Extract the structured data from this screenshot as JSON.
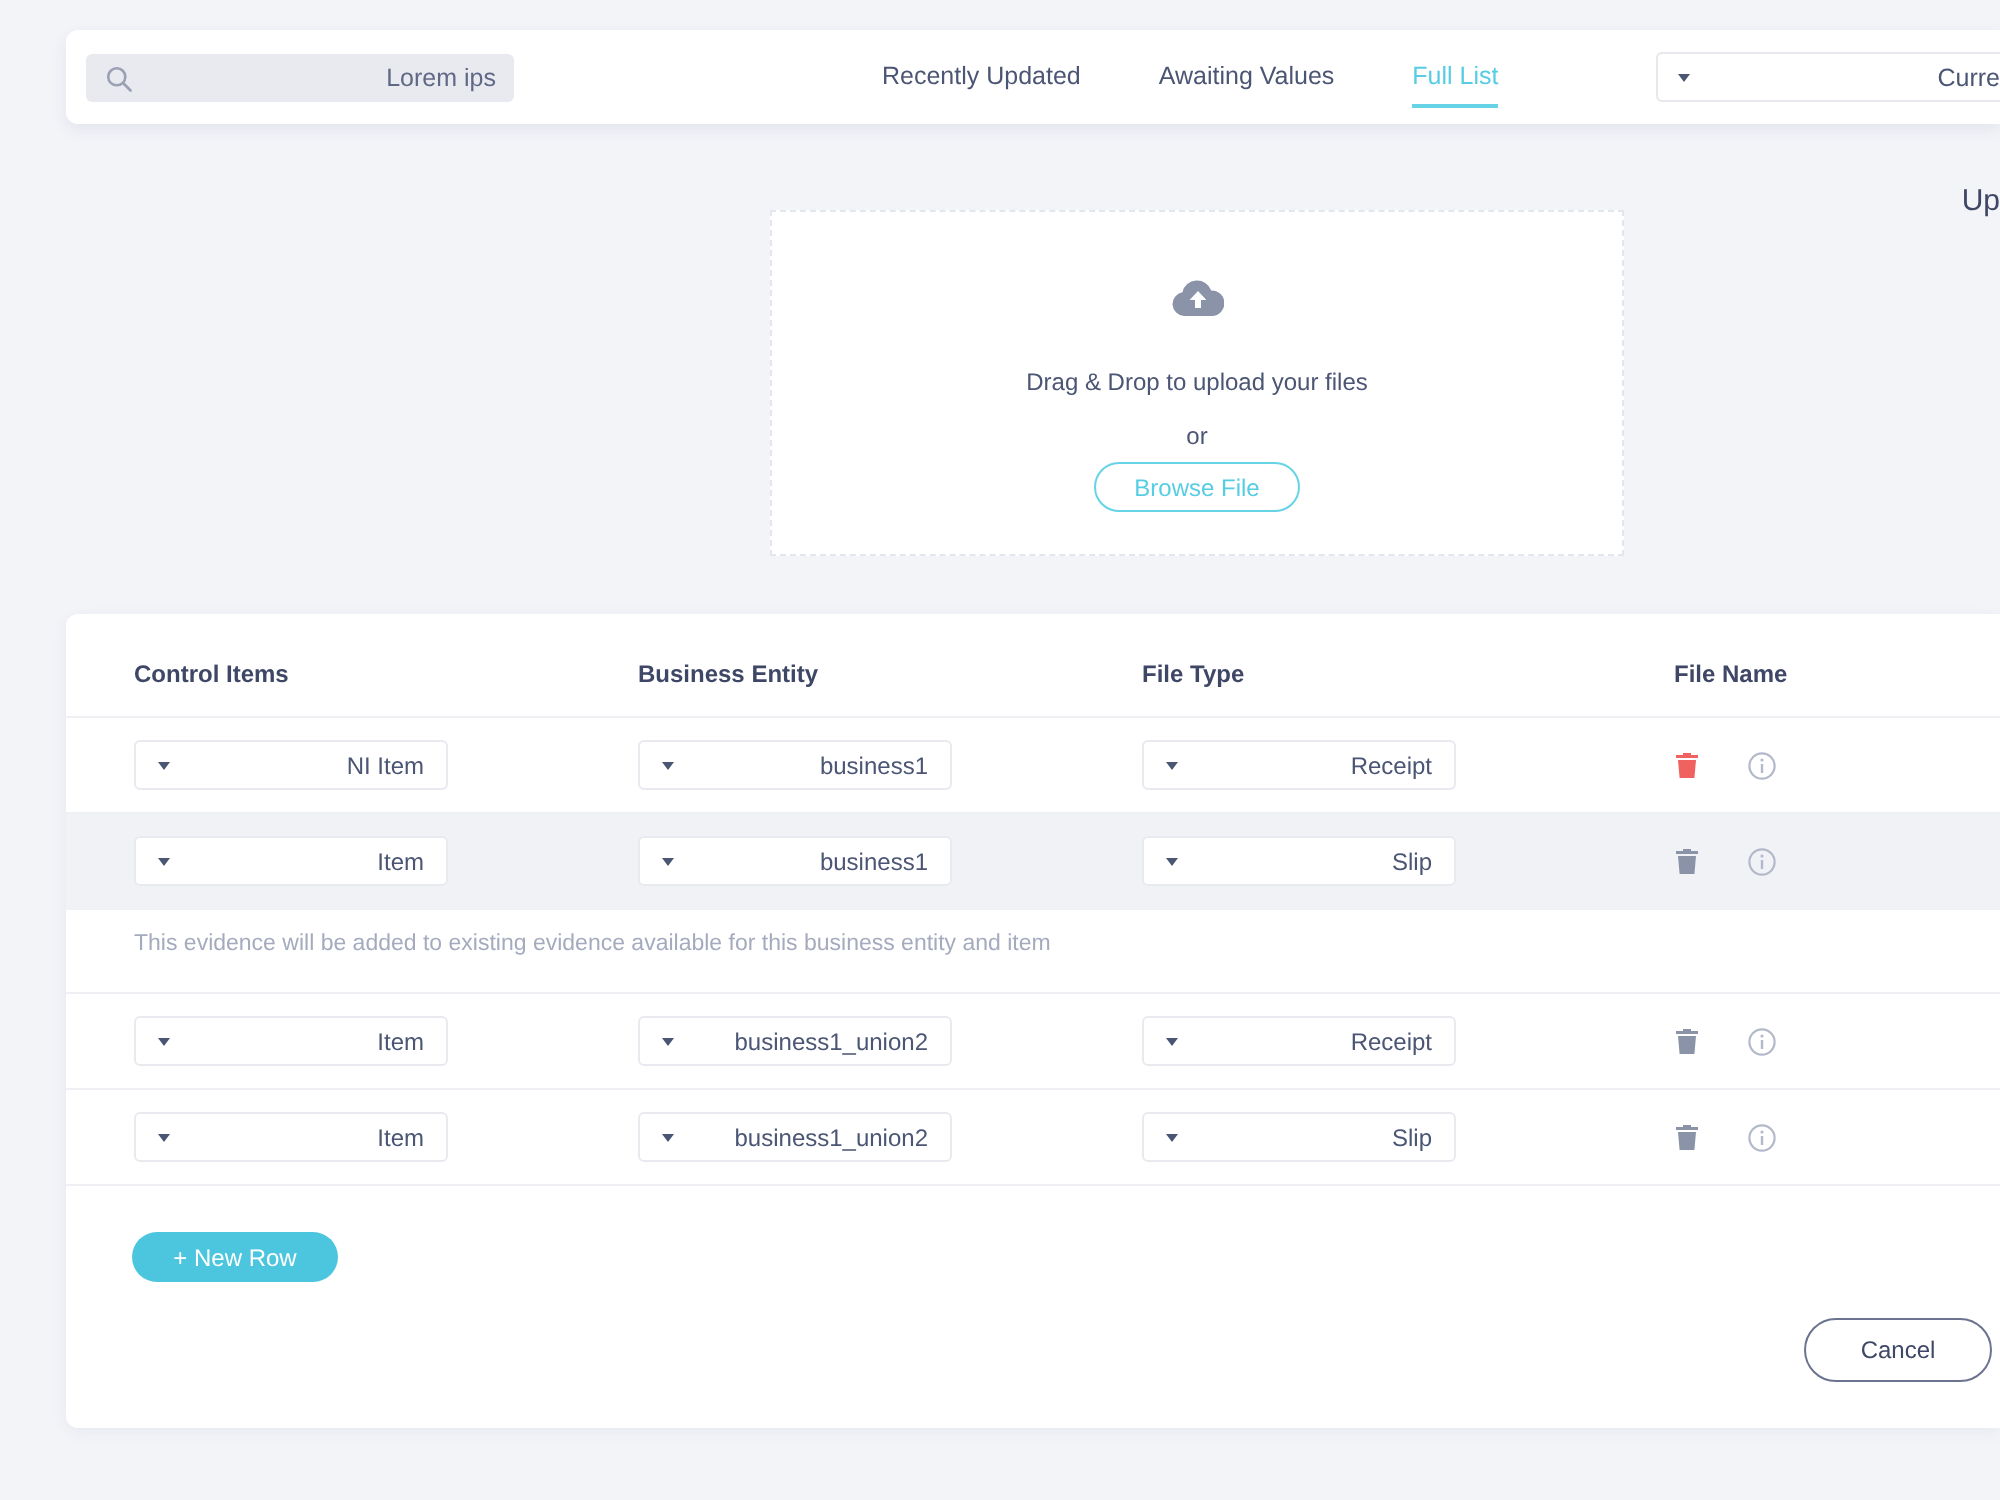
{
  "search": {
    "value": "Lorem ips"
  },
  "tabs": [
    {
      "label": "Recently Updated",
      "selected": false
    },
    {
      "label": "Awaiting Values",
      "selected": false
    },
    {
      "label": "Full List",
      "selected": true
    }
  ],
  "filter_dropdown": {
    "value": "Curre"
  },
  "side_heading": "Up",
  "upload": {
    "prompt": "Drag & Drop to upload your files",
    "separator": "or",
    "button": "Browse File"
  },
  "table": {
    "columns": [
      "Control Items",
      "Business Entity",
      "File Type",
      "File Name"
    ],
    "rows": [
      {
        "control_item": "NI Item",
        "business_entity": "business1",
        "file_type": "Receipt",
        "highlighted": false,
        "delete_active": true
      },
      {
        "control_item": "Item",
        "business_entity": "business1",
        "file_type": "Slip",
        "highlighted": true,
        "delete_active": false,
        "note": "This evidence will be added to existing evidence available for this business entity and item"
      },
      {
        "control_item": "Item",
        "business_entity": "business1_union2",
        "file_type": "Receipt",
        "highlighted": false,
        "delete_active": false
      },
      {
        "control_item": "Item",
        "business_entity": "business1_union2",
        "file_type": "Slip",
        "highlighted": false,
        "delete_active": false
      }
    ]
  },
  "new_row_button": "+ New Row",
  "cancel_button": "Cancel"
}
